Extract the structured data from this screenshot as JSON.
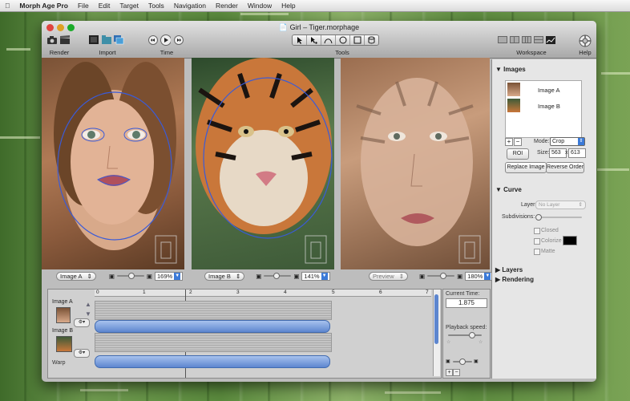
{
  "menubar": {
    "app": "Morph Age Pro",
    "items": [
      "File",
      "Edit",
      "Target",
      "Tools",
      "Navigation",
      "Render",
      "Window",
      "Help"
    ]
  },
  "window": {
    "title": "Girl – Tiger.morphage"
  },
  "toolbar": {
    "render_label": "Render",
    "import_label": "Import",
    "time_label": "Time",
    "tools_label": "Tools",
    "workspace_label": "Workspace",
    "help_label": "Help"
  },
  "panes": {
    "a": {
      "selector": "Image A",
      "zoom": "169%"
    },
    "b": {
      "selector": "Image B",
      "zoom": "141%"
    },
    "preview": {
      "selector": "Preview",
      "zoom": "180%"
    }
  },
  "timeline": {
    "ruler": [
      "0",
      "1",
      "2",
      "3",
      "4",
      "5",
      "6",
      "7"
    ],
    "row_a": "Image A",
    "row_b": "Image B",
    "row_warp": "Warp",
    "current_time_label": "Current Time:",
    "current_time": "1.875",
    "playback_label": "Playback speed:"
  },
  "panel": {
    "images_title": "Images",
    "image_list": [
      "Image A",
      "Image B"
    ],
    "mode_label": "Mode:",
    "mode_value": "Crop",
    "roi_label": "ROI",
    "size_label": "Size:",
    "size_w": "563",
    "size_x": "x",
    "size_h": "613",
    "replace_label": "Replace Image",
    "reverse_label": "Reverse Order",
    "curve_title": "Curve",
    "layer_label": "Layer:",
    "layer_value": "No Layer",
    "subdiv_label": "Subdivisions:",
    "closed_label": "Closed",
    "colorize_label": "Colorize",
    "matte_label": "Matte",
    "layers_title": "Layers",
    "rendering_title": "Rendering"
  },
  "colors": {
    "accent": "#3b7ad8",
    "curve": "#2a5bd8"
  }
}
